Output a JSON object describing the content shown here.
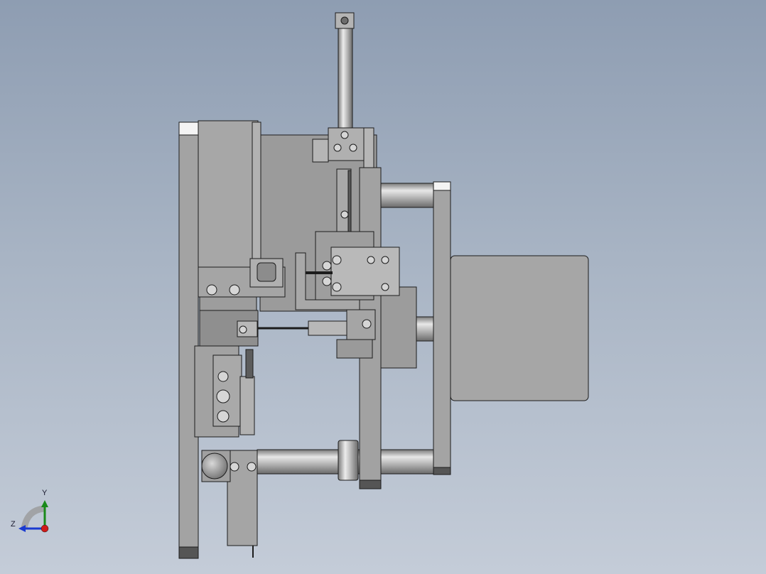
{
  "axis_triad": {
    "y_label": "Y",
    "z_label": "Z",
    "colors": {
      "y": "#1a8a1a",
      "z": "#1a3ad0",
      "x": "#d01a1a"
    }
  },
  "colors": {
    "background_top": "#8e9db2",
    "background_bottom": "#c4ccd8",
    "part_fill": "#a0a0a0",
    "part_dark": "#7c7c7c",
    "edge": "#1c1c1c"
  }
}
